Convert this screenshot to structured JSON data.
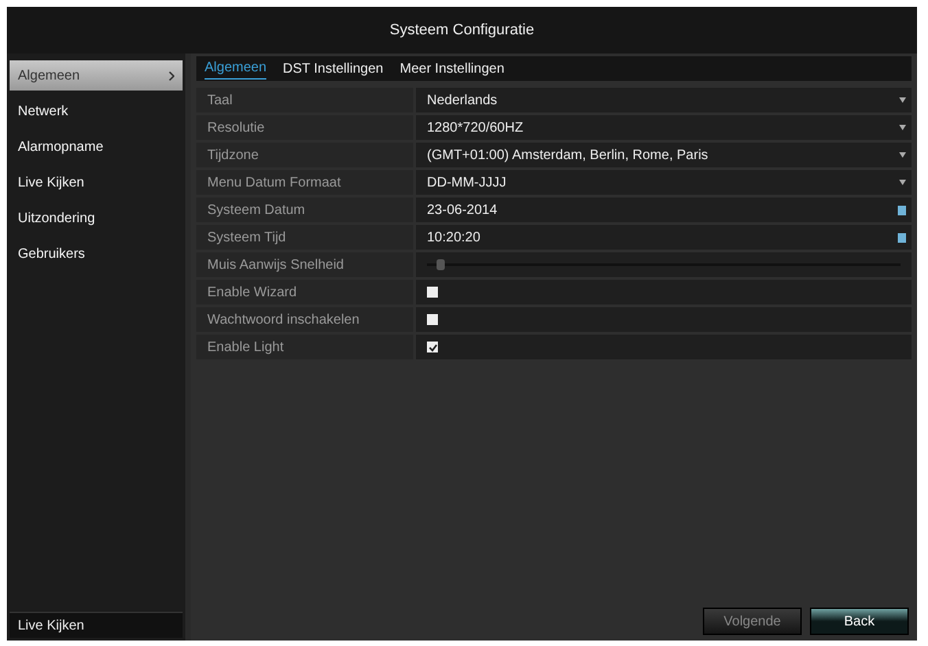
{
  "window": {
    "title": "Systeem Configuratie"
  },
  "sidebar": {
    "items": [
      {
        "label": "Algemeen",
        "selected": true
      },
      {
        "label": "Netwerk",
        "selected": false
      },
      {
        "label": "Alarmopname",
        "selected": false
      },
      {
        "label": "Live Kijken",
        "selected": false
      },
      {
        "label": "Uitzondering",
        "selected": false
      },
      {
        "label": "Gebruikers",
        "selected": false
      }
    ],
    "footer": "Live Kijken"
  },
  "tabs": [
    {
      "label": "Algemeen",
      "selected": true
    },
    {
      "label": "DST Instellingen",
      "selected": false
    },
    {
      "label": "Meer Instellingen",
      "selected": false
    }
  ],
  "settings": [
    {
      "label": "Taal",
      "kind": "select",
      "value": "Nederlands"
    },
    {
      "label": "Resolutie",
      "kind": "select",
      "value": "1280*720/60HZ"
    },
    {
      "label": "Tijdzone",
      "kind": "select",
      "value": "(GMT+01:00) Amsterdam, Berlin, Rome, Paris"
    },
    {
      "label": "Menu Datum Formaat",
      "kind": "select",
      "value": "DD-MM-JJJJ"
    },
    {
      "label": "Systeem Datum",
      "kind": "date",
      "value": "23-06-2014"
    },
    {
      "label": "Systeem Tijd",
      "kind": "time",
      "value": "10:20:20"
    },
    {
      "label": "Muis Aanwijs Snelheid",
      "kind": "slider",
      "level": 0.02
    },
    {
      "label": "Enable Wizard",
      "kind": "checkbox",
      "checked": false
    },
    {
      "label": "Wachtwoord inschakelen",
      "kind": "checkbox",
      "checked": false
    },
    {
      "label": "Enable Light",
      "kind": "checkbox",
      "checked": true
    }
  ],
  "buttons": [
    {
      "label": "Volgende",
      "disabled": true
    },
    {
      "label": "Back",
      "disabled": false
    }
  ]
}
